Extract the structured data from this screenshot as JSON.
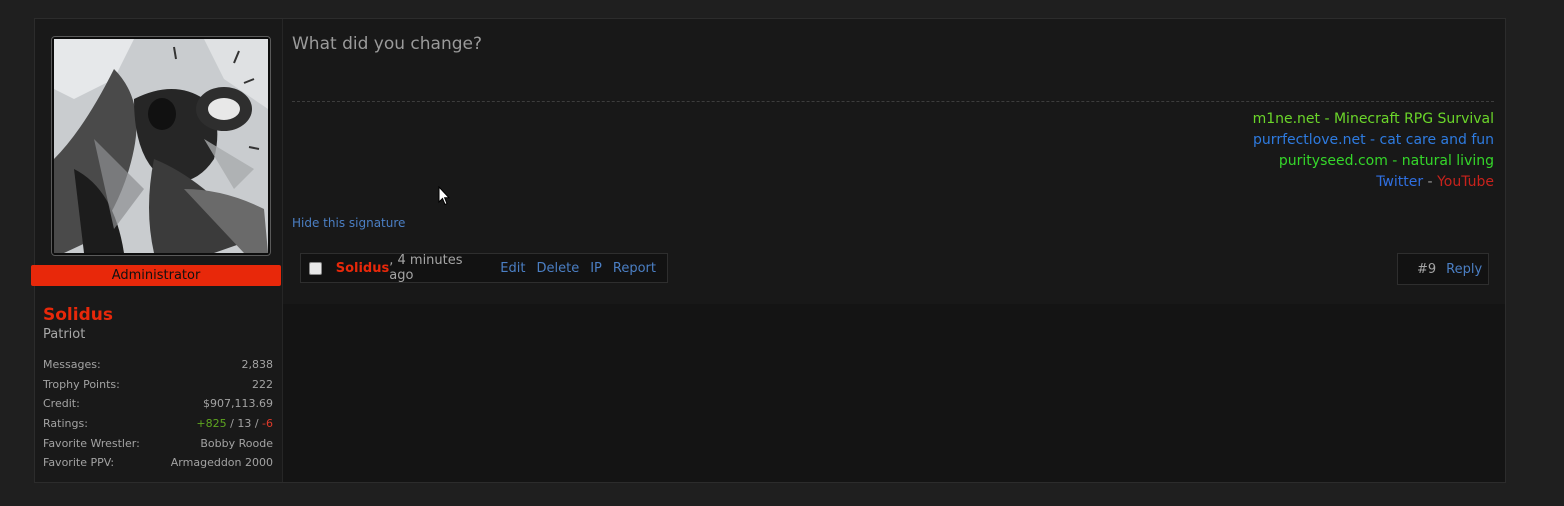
{
  "user": {
    "role": "Administrator",
    "name": "Solidus",
    "title": "Patriot",
    "stats": {
      "messages_label": "Messages:",
      "messages_value": "2,838",
      "trophy_label": "Trophy Points:",
      "trophy_value": "222",
      "credit_label": "Credit:",
      "credit_value": "$907,113.69",
      "ratings_label": "Ratings:",
      "ratings_positive": "+825",
      "ratings_sep1": " / ",
      "ratings_neutral": "13",
      "ratings_sep2": " / ",
      "ratings_negative": "-6",
      "wrestler_label": "Favorite Wrestler:",
      "wrestler_value": "Bobby Roode",
      "ppv_label": "Favorite PPV:",
      "ppv_value": "Armageddon 2000"
    }
  },
  "post": {
    "message": "What did you change?",
    "signature": {
      "line1": "m1ne.net - Minecraft RPG Survival",
      "line2": "purrfectlove.net - cat care and fun",
      "line3": "purityseed.com - natural living",
      "twitter": "Twitter",
      "separator": " - ",
      "youtube": "YouTube"
    },
    "hide_signature": "Hide this signature",
    "meta": {
      "author": "Solidus",
      "time": ", 4 minutes ago",
      "edit": "Edit",
      "delete": "Delete",
      "ip": "IP",
      "report": "Report",
      "post_number": "#9",
      "reply": "Reply"
    }
  },
  "colors": {
    "accent_red": "#e8280a",
    "link_blue": "#4b7fc4",
    "background": "#1f1f1f"
  }
}
